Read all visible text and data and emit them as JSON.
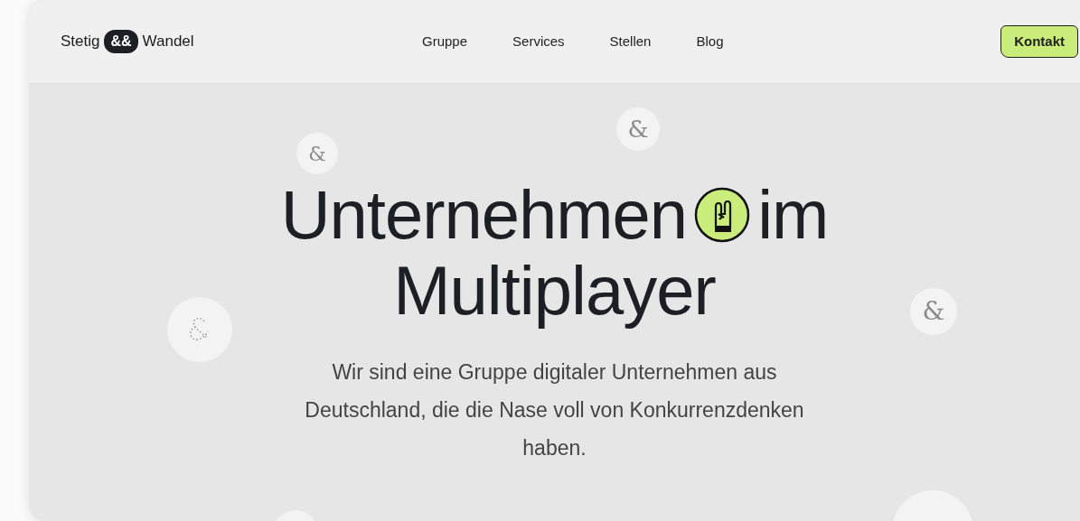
{
  "header": {
    "logo": {
      "left": "Stetig",
      "mark": "&&",
      "right": "Wandel"
    },
    "nav": [
      {
        "label": "Gruppe"
      },
      {
        "label": "Services"
      },
      {
        "label": "Stellen"
      },
      {
        "label": "Blog"
      }
    ],
    "cta": "Kontakt"
  },
  "hero": {
    "title_start": "Unternehmen",
    "title_end": "im",
    "title_line2": "Multiplayer",
    "text": "Wir sind eine Gruppe digitaler Unternehmen aus Deutschland, die die Nase voll von Konkurrenzdenken haben."
  },
  "badges": [
    {
      "kind": "glyph",
      "text": "&"
    },
    {
      "kind": "glyph",
      "text": "&"
    },
    {
      "kind": "dotted"
    },
    {
      "kind": "glyph",
      "text": "&"
    },
    {
      "kind": "blank"
    },
    {
      "kind": "blank"
    }
  ]
}
